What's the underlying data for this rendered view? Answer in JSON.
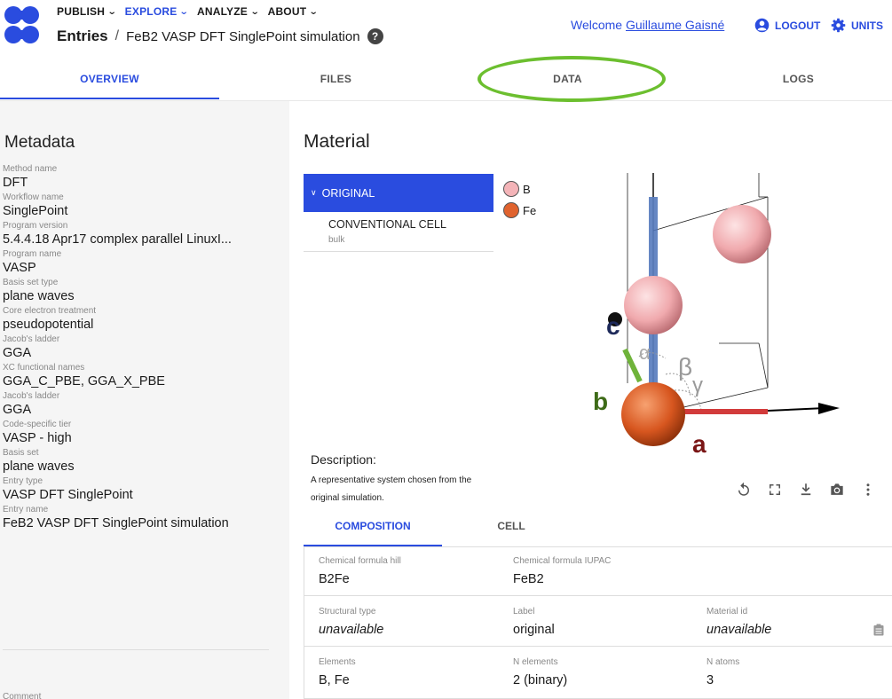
{
  "header": {
    "nav": [
      {
        "label": "PUBLISH",
        "active": false
      },
      {
        "label": "EXPLORE",
        "active": true
      },
      {
        "label": "ANALYZE",
        "active": false
      },
      {
        "label": "ABOUT",
        "active": false
      }
    ],
    "breadcrumb_root": "Entries",
    "breadcrumb_sep": "/",
    "breadcrumb_leaf": "FeB2 VASP DFT SinglePoint simulation",
    "help_glyph": "?",
    "welcome_prefix": "Welcome",
    "user_name": "Guillaume Gaisné",
    "logout_label": "LOGOUT",
    "units_label": "UNITS",
    "accent_color": "#2a4cdf"
  },
  "tabs": [
    {
      "label": "OVERVIEW",
      "active": true
    },
    {
      "label": "FILES",
      "active": false
    },
    {
      "label": "DATA",
      "active": false
    },
    {
      "label": "LOGS",
      "active": false
    }
  ],
  "annotation": {
    "highlight_color": "#6cbf2f"
  },
  "metadata": {
    "title": "Metadata",
    "items": [
      {
        "label": "Method name",
        "value": "DFT"
      },
      {
        "label": "Workflow name",
        "value": "SinglePoint"
      },
      {
        "label": "Program version",
        "value": "5.4.4.18 Apr17 complex parallel LinuxI..."
      },
      {
        "label": "Program name",
        "value": "VASP"
      },
      {
        "label": "Basis set type",
        "value": "plane waves"
      },
      {
        "label": "Core electron treatment",
        "value": "pseudopotential"
      },
      {
        "label": "Jacob's ladder",
        "value": "GGA"
      },
      {
        "label": "XC functional names",
        "value": "GGA_C_PBE, GGA_X_PBE"
      },
      {
        "label": "Jacob's ladder",
        "value": "GGA"
      },
      {
        "label": "Code-specific tier",
        "value": "VASP - high"
      },
      {
        "label": "Basis set",
        "value": "plane waves"
      },
      {
        "label": "Entry type",
        "value": "VASP DFT SinglePoint"
      },
      {
        "label": "Entry name",
        "value": "FeB2 VASP DFT SinglePoint simulation"
      }
    ],
    "comment_label": "Comment"
  },
  "material": {
    "title": "Material",
    "tree": {
      "selected": "ORIGINAL",
      "child_label": "CONVENTIONAL CELL",
      "child_sub": "bulk"
    },
    "legend": [
      {
        "symbol": "B",
        "color": "#f4b4b8"
      },
      {
        "symbol": "Fe",
        "color": "#e0632e"
      }
    ],
    "axes": {
      "a": "a",
      "b": "b",
      "c": "c",
      "alpha": "α",
      "beta": "β",
      "gamma": "γ"
    },
    "description_title": "Description:",
    "description_text": "A representative system chosen from the original simulation.",
    "tools": [
      "reset-view-icon",
      "fullscreen-icon",
      "download-icon",
      "camera-icon",
      "more-vert-icon"
    ]
  },
  "subtabs": [
    {
      "label": "COMPOSITION",
      "active": true
    },
    {
      "label": "CELL",
      "active": false
    }
  ],
  "composition": {
    "rows": [
      [
        {
          "label": "Chemical formula hill",
          "value": "B2Fe",
          "italic": false
        },
        {
          "label": "Chemical formula IUPAC",
          "value": "FeB2",
          "italic": false
        }
      ],
      [
        {
          "label": "Structural type",
          "value": "unavailable",
          "italic": true
        },
        {
          "label": "Label",
          "value": "original",
          "italic": false
        },
        {
          "label": "Material id",
          "value": "unavailable",
          "italic": true
        }
      ],
      [
        {
          "label": "Elements",
          "value": "B, Fe",
          "italic": false
        },
        {
          "label": "N elements",
          "value": "2 (binary)",
          "italic": false
        },
        {
          "label": "N atoms",
          "value": "3",
          "italic": false
        }
      ]
    ]
  }
}
